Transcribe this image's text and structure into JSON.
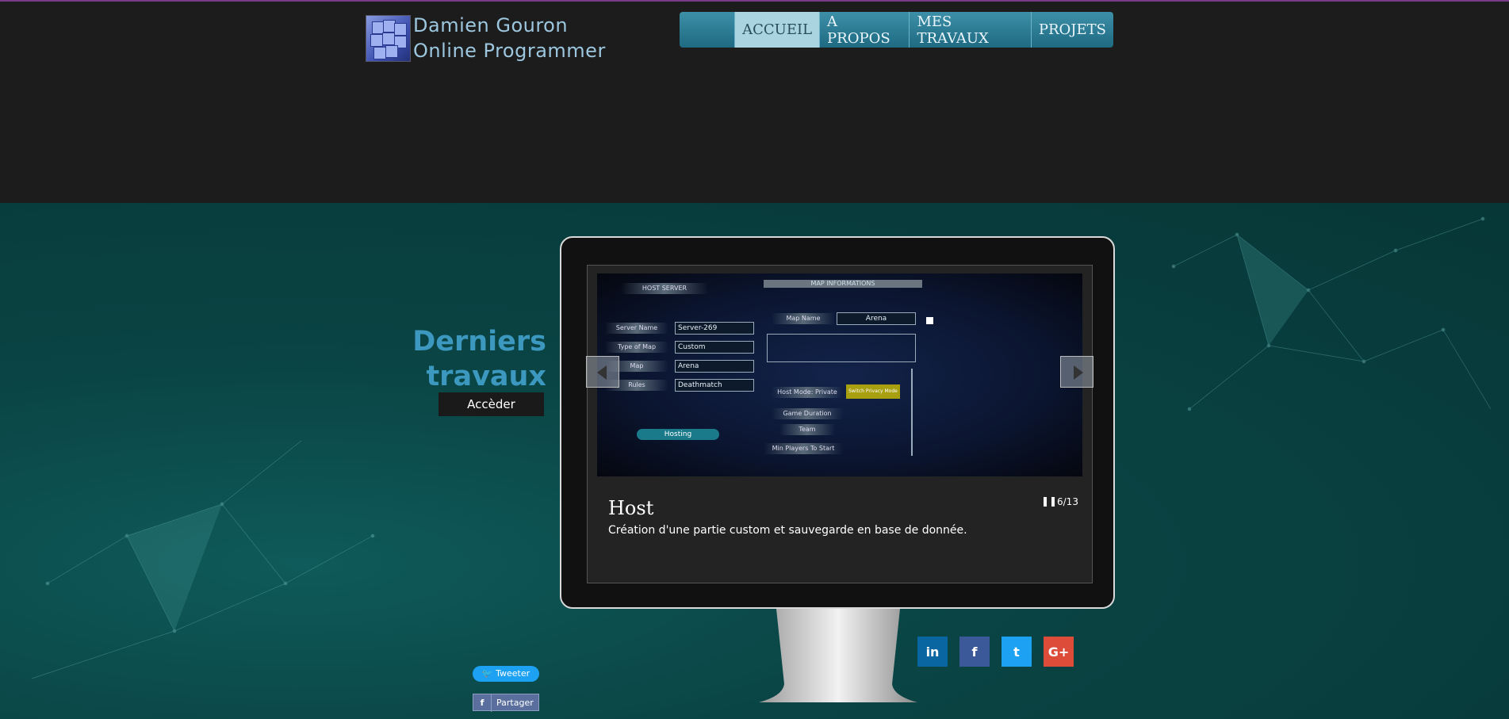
{
  "brand": {
    "line1": "Damien Gouron",
    "line2": "Online Programmer",
    "logo_icon": "cube-logo-icon"
  },
  "nav": {
    "items": [
      "ACCUEIL",
      "A PROPOS",
      "MES TRAVAUX",
      "PROJETS"
    ],
    "active": "ACCUEIL"
  },
  "section": {
    "title_line1": "Derniers",
    "title_line2": "travaux",
    "button": "Accèder"
  },
  "slide": {
    "title": "Host",
    "description": "Création d'une partie custom et sauvegarde en base de donnée.",
    "counter": "6/13",
    "pause_icon": "pause-icon",
    "screenshot": {
      "host_server": "HOST SERVER",
      "map_info": "MAP INFORMATIONS",
      "server_name_label": "Server Name",
      "server_name_value": "Server-269",
      "type_label": "Type of Map",
      "type_value": "Custom",
      "map_label": "Map",
      "map_value": "Arena",
      "rules_label": "Rules",
      "rules_value": "Deathmatch",
      "map_name_label": "Map Name",
      "map_name_value": "Arena",
      "host_mode": "Host Mode: Private",
      "switch_privacy": "Switch Privacy Mode",
      "game_duration": "Game Duration",
      "team": "Team",
      "min_players": "Min Players To Start",
      "hosting": "Hosting"
    }
  },
  "social": [
    {
      "name": "linkedin",
      "label": "in",
      "color": "#0a66a0"
    },
    {
      "name": "facebook",
      "label": "f",
      "color": "#3b5998"
    },
    {
      "name": "twitter",
      "label": "t",
      "color": "#1da1f2"
    },
    {
      "name": "google-plus",
      "label": "G+",
      "color": "#dd4b39"
    }
  ],
  "share": {
    "tweet": "Tweeter",
    "facebook": "Partager"
  }
}
